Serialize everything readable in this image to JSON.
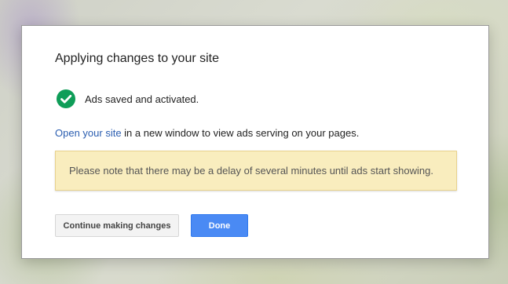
{
  "dialog": {
    "title": "Applying changes to your site",
    "status": {
      "icon": "check-circle-icon",
      "icon_color": "#0f9d58",
      "text": "Ads saved and activated."
    },
    "info": {
      "link_text": "Open your site",
      "rest_text": " in a new window to view ads serving on your pages."
    },
    "notice": {
      "text": "Please note that there may be a delay of several minutes until ads start showing.",
      "background": "#f9edbe"
    },
    "buttons": {
      "secondary_label": "Continue making changes",
      "primary_label": "Done",
      "primary_color": "#4a8af4"
    }
  }
}
